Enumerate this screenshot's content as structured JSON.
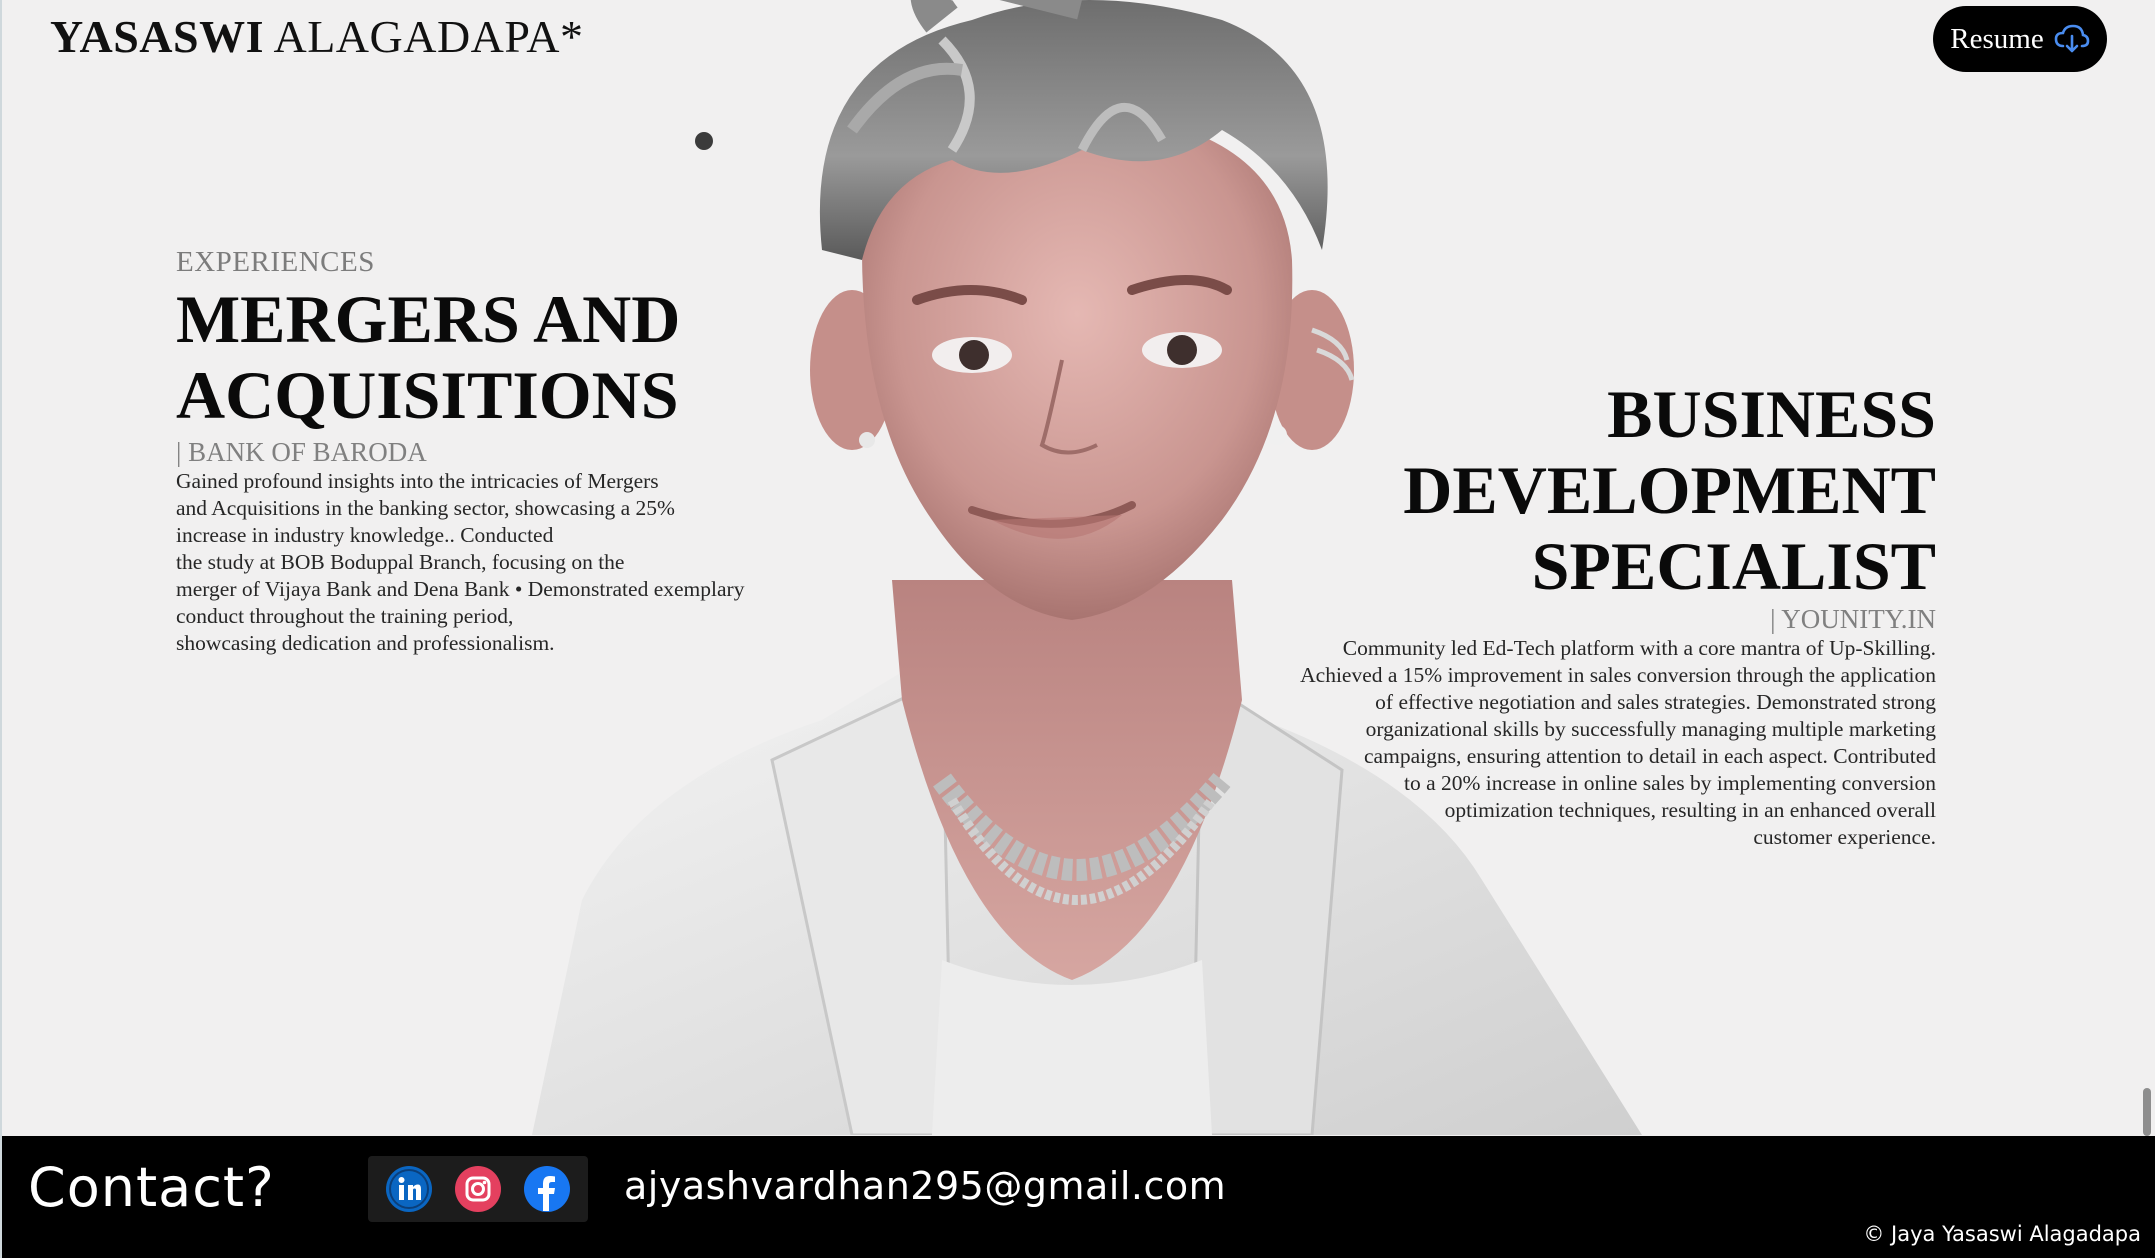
{
  "header": {
    "brand_first": "YASASWI",
    "brand_last": "ALAGADAPA*",
    "resume_label": "Resume",
    "resume_icon": "cloud-download-icon"
  },
  "experiences": {
    "section_label": "EXPERIENCES",
    "left": {
      "title_line1": "MERGERS AND",
      "title_line2": "ACQUISITIONS",
      "company": "| BANK OF BARODA",
      "description_lines": [
        "Gained profound insights into the intricacies of Mergers",
        "and Acquisitions in the banking sector, showcasing a 25%",
        "increase in industry knowledge.. Conducted",
        "the study at BOB Boduppal Branch, focusing on the",
        "merger of Vijaya Bank and Dena Bank • Demonstrated exemplary",
        "conduct throughout the training period,",
        "showcasing dedication and professionalism."
      ]
    },
    "right": {
      "title_line1": "BUSINESS",
      "title_line2": "DEVELOPMENT",
      "title_line3": "SPECIALIST",
      "company": "| YOUNITY.IN",
      "description_lines": [
        "Community led Ed-Tech platform with a core mantra of Up-Skilling.",
        "Achieved a 15% improvement in sales conversion through the application",
        "of effective negotiation and sales strategies. Demonstrated strong",
        "organizational skills by successfully managing multiple marketing",
        "campaigns, ensuring attention to detail in each aspect. Contributed",
        "to a 20% increase in online sales by implementing conversion",
        "optimization techniques, resulting in an enhanced overall",
        "customer experience."
      ]
    }
  },
  "footer": {
    "contact_title": "Contact?",
    "socials": [
      {
        "name": "linkedin-icon",
        "color": "#0a66c2"
      },
      {
        "name": "instagram-icon",
        "color": "#e4405f"
      },
      {
        "name": "facebook-icon",
        "color": "#1877f2"
      }
    ],
    "email": "ajyashvardhan295@gmail.com",
    "copyright": "© Jaya Yasaswi Alagadapa"
  },
  "colors": {
    "background": "#f1f0f0",
    "footer_bg": "#000000",
    "resume_bg": "#000000",
    "resume_icon": "#4a8df0"
  }
}
